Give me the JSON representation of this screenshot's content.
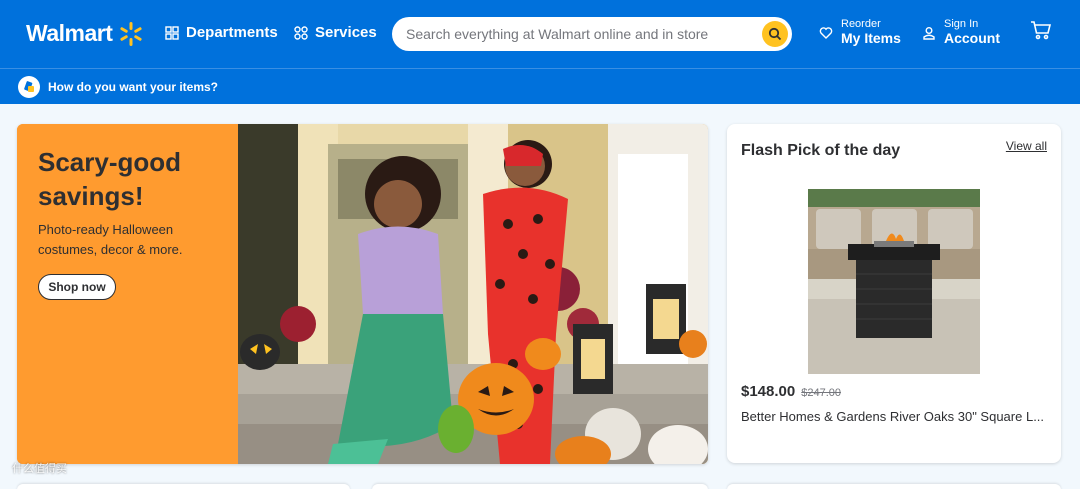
{
  "header": {
    "logo_text": "Walmart",
    "departments_label": "Departments",
    "services_label": "Services",
    "search_placeholder": "Search everything at Walmart online and in store",
    "reorder_small": "Reorder",
    "reorder_big": "My Items",
    "signin_small": "Sign In",
    "signin_big": "Account",
    "icons": [
      "spark-logo-icon",
      "grid-icon",
      "services-icon",
      "search-icon",
      "heart-icon",
      "user-icon",
      "cart-icon"
    ]
  },
  "subheader": {
    "text": "How do you want your items?",
    "icon": "fulfillment-icon"
  },
  "hero": {
    "title": "Scary-good savings!",
    "subtitle": "Photo-ready Halloween costumes, decor & more.",
    "button_label": "Shop now",
    "background_color": "#ff9b2f"
  },
  "flash_pick": {
    "title": "Flash Pick of the day",
    "view_all_label": "View all",
    "price_now": "$148.00",
    "price_was": "$247.00",
    "product_name": "Better Homes & Gardens River Oaks 30\" Square L..."
  },
  "watermark": "什么值得买",
  "colors": {
    "brand_blue": "#0071dc",
    "spark_yellow": "#ffc220",
    "hero_orange": "#ff9b2f"
  }
}
